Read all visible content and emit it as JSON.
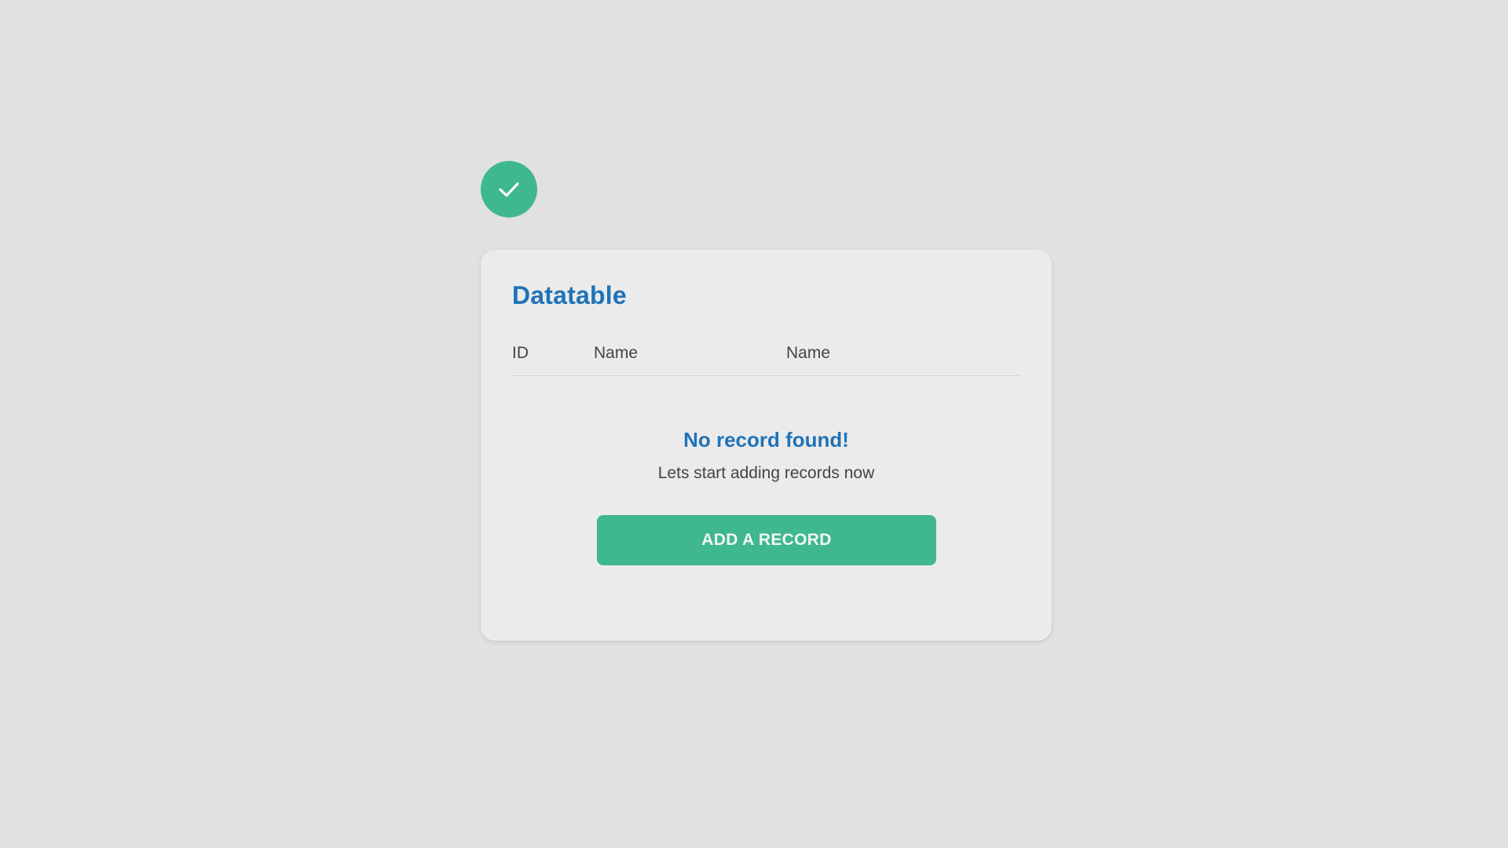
{
  "status": {
    "icon": "check-icon",
    "color": "#3fb88e"
  },
  "card": {
    "title": "Datatable",
    "title_color": "#1f73b7",
    "columns": [
      "ID",
      "Name",
      "Name"
    ]
  },
  "empty_state": {
    "title": "No record found!",
    "subtitle": "Lets start adding records now"
  },
  "actions": {
    "add_label": "ADD A RECORD",
    "add_color": "#3fb88e"
  }
}
